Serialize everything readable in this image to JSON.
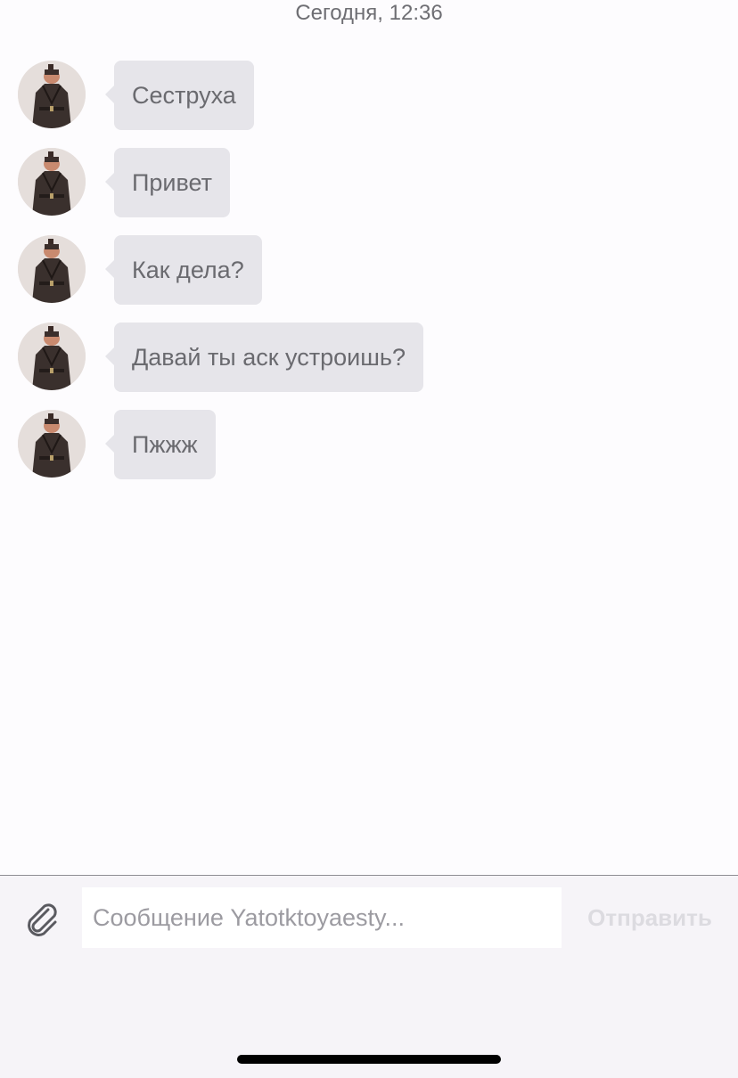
{
  "header": {
    "timestamp": "Сегодня, 12:36"
  },
  "messages": [
    {
      "text": "Сеструха"
    },
    {
      "text": "Привет"
    },
    {
      "text": "Как дела?"
    },
    {
      "text": "Давай ты аск устроишь?"
    },
    {
      "text": "Пжжж"
    }
  ],
  "composer": {
    "placeholder": "Сообщение Yatotktoyaesty...",
    "send_label": "Отправить",
    "attach_icon": "paperclip-icon"
  },
  "colors": {
    "bubble": "#e6e5ea",
    "bubble_text": "#6a6a6f",
    "send_disabled": "#dcdbe0",
    "composer_bg": "#f6f4f8"
  }
}
